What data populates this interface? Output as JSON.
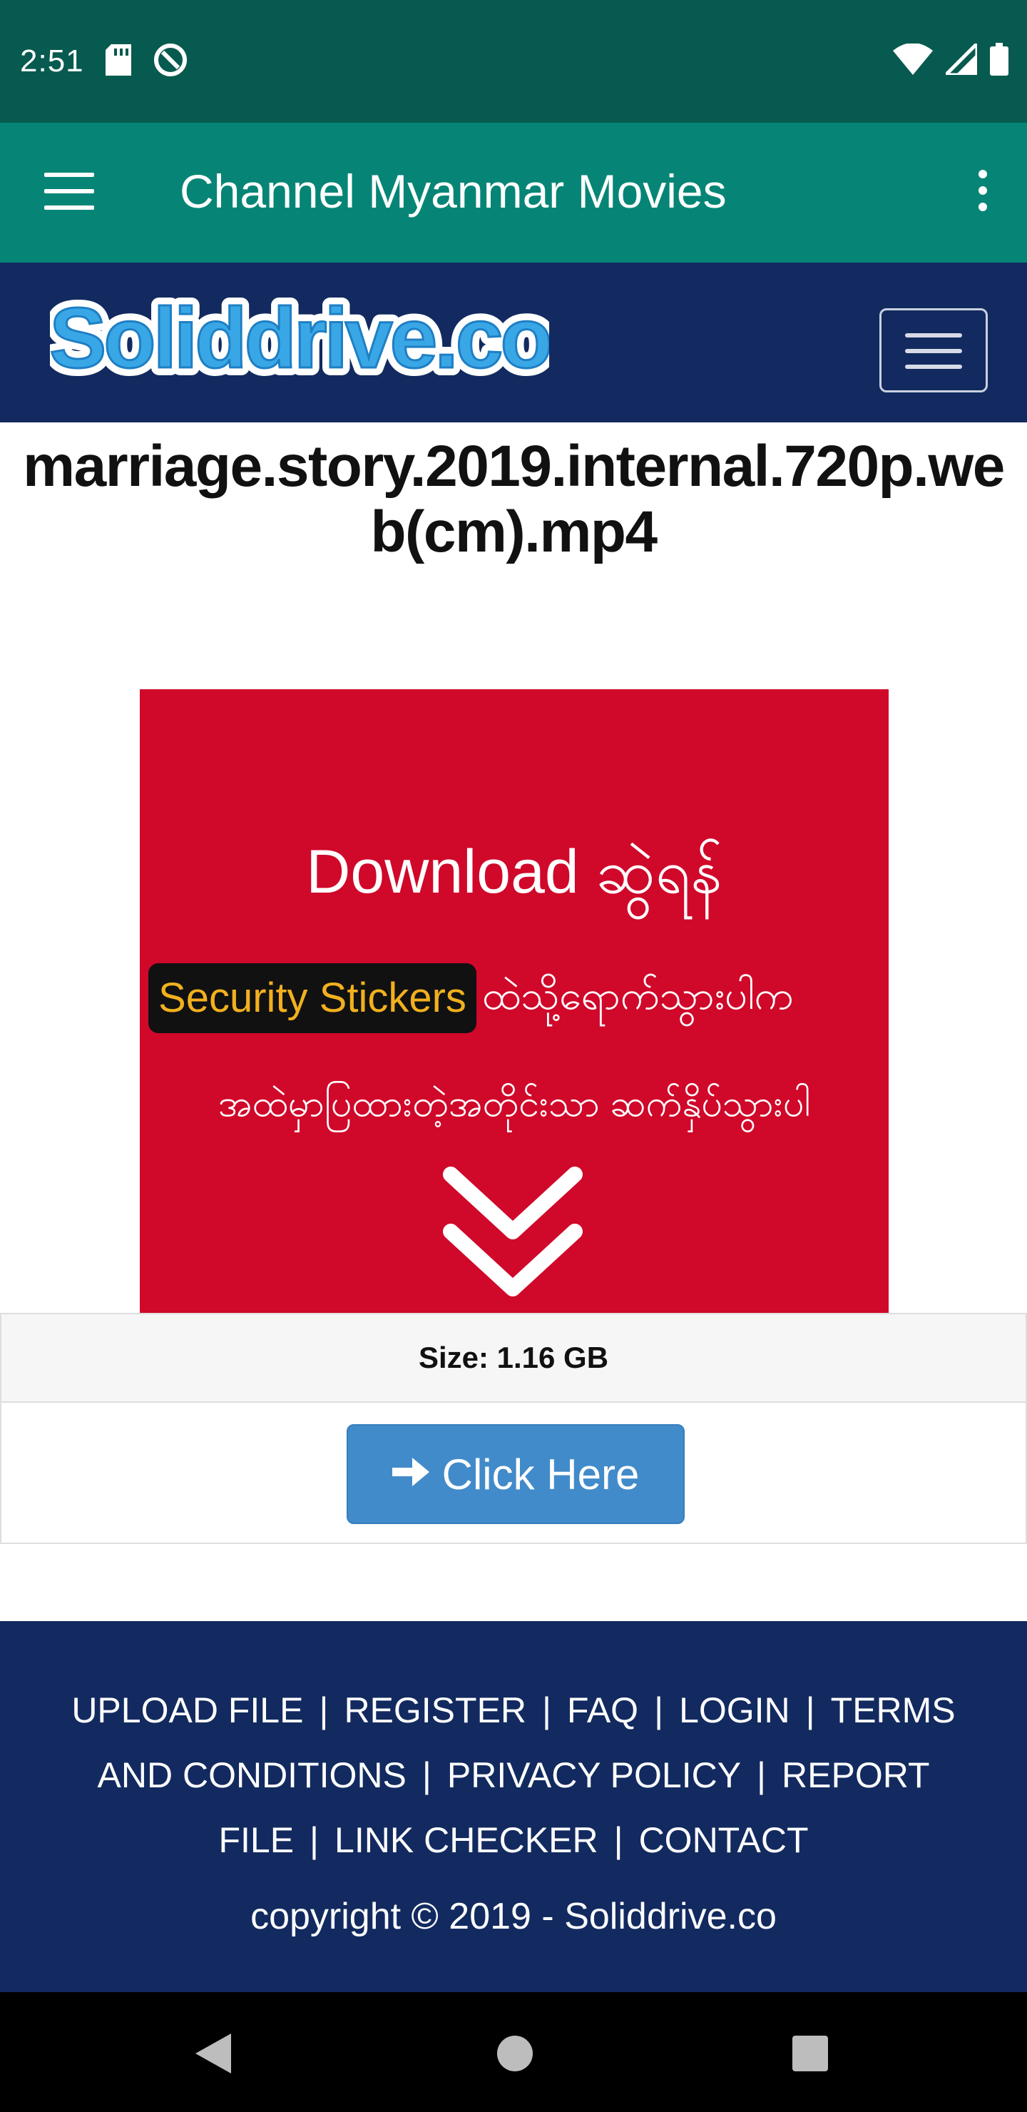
{
  "status_bar": {
    "time": "2:51"
  },
  "app_bar": {
    "title": "Channel Myanmar Movies"
  },
  "site": {
    "logo_text": "Soliddrive.co"
  },
  "file": {
    "name": "marriage.story.2019.internal.720p.web(cm).mp4",
    "size": "Size: 1.16 GB"
  },
  "banner": {
    "line1": "Download ဆွဲရန်",
    "pill": "Security Stickers",
    "line2": "ထဲသို့ရောက်သွားပါက",
    "line3": "အထဲမှာပြထားတဲ့အတိုင်းသာ ဆက်နှိပ်သွားပါ"
  },
  "click_button": {
    "label": "Click Here"
  },
  "footer": {
    "links": [
      "UPLOAD FILE",
      "REGISTER",
      "FAQ",
      "LOGIN",
      "TERMS AND CONDITIONS",
      "PRIVACY POLICY",
      "REPORT FILE",
      "LINK CHECKER",
      "CONTACT"
    ],
    "copyright": "copyright © 2019 - Soliddrive.co"
  },
  "colors": {
    "status_bar": "#075a4f",
    "app_bar": "#068576",
    "site_header": "#122a5f",
    "banner": "#d0082a",
    "button": "#428bca",
    "pill_text": "#f2b01e"
  }
}
